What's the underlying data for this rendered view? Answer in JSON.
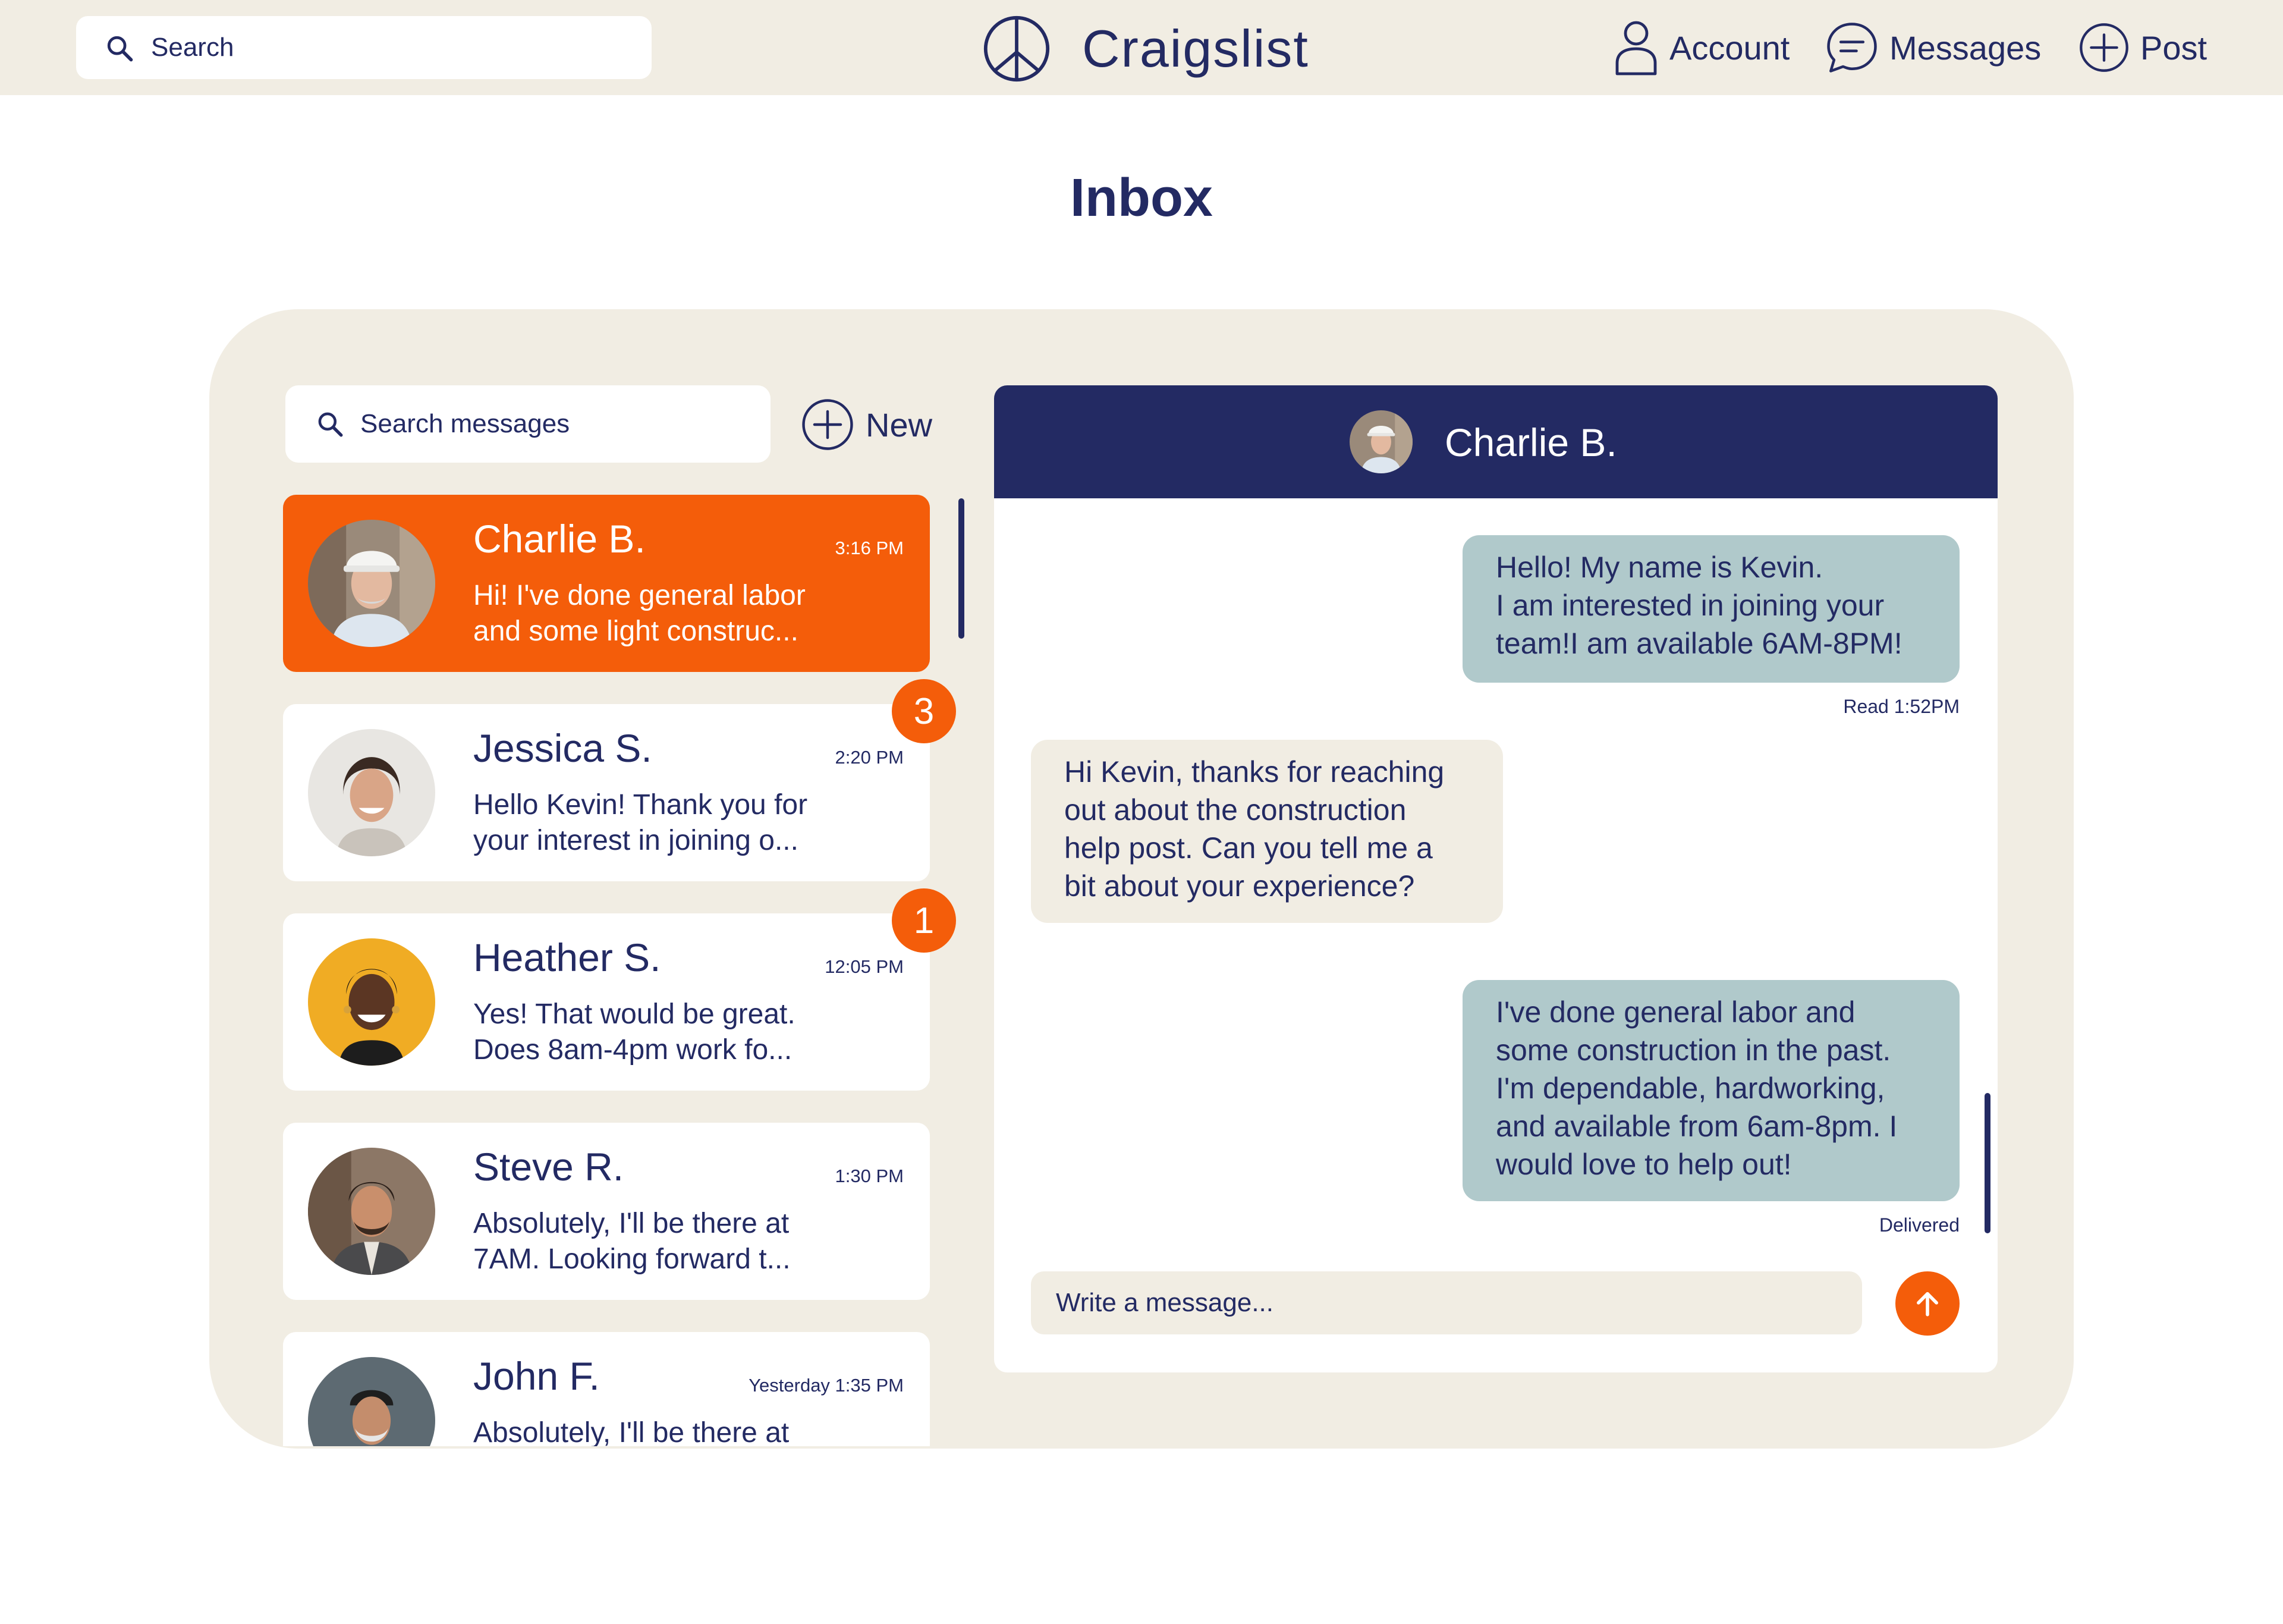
{
  "colors": {
    "navy": "#232a63",
    "beige": "#f1ede3",
    "orange": "#f45d0a",
    "outgoing_bubble": "#b0c9cb"
  },
  "header": {
    "search": {
      "placeholder": "Search",
      "icon": "search-icon"
    },
    "brand": {
      "name": "Craigslist",
      "icon": "peace-sign-icon"
    },
    "nav": [
      {
        "label": "Account",
        "icon": "user-icon"
      },
      {
        "label": "Messages",
        "icon": "chat-bubble-icon"
      },
      {
        "label": "Post",
        "icon": "plus-circle-icon"
      }
    ]
  },
  "page": {
    "title": "Inbox"
  },
  "inbox": {
    "search_placeholder": "Search messages",
    "new_label": "New",
    "conversations": [
      {
        "name": "Charlie B.",
        "time": "3:16 PM",
        "preview": "Hi! I've done general labor and some light construc...",
        "active": true
      },
      {
        "name": "Jessica S.",
        "time": "2:20 PM",
        "preview": "Hello Kevin! Thank you for your interest in joining o...",
        "unread": "3"
      },
      {
        "name": "Heather S.",
        "time": "12:05 PM",
        "preview": "Yes! That would be great. Does 8am-4pm work fo...",
        "unread": "1"
      },
      {
        "name": "Steve R.",
        "time": "1:30 PM",
        "preview": "Absolutely, I'll be there at 7AM. Looking forward t..."
      },
      {
        "name": "John F.",
        "time": "Yesterday 1:35 PM",
        "preview": "Absolutely, I'll be there at"
      }
    ]
  },
  "chat": {
    "contact_name": "Charlie B.",
    "messages": [
      {
        "direction": "outgoing",
        "lines": [
          "Hello! My name is Kevin.",
          "I am interested in joining your",
          "team!I am available 6AM-8PM!"
        ],
        "status": "Read 1:52PM"
      },
      {
        "direction": "incoming",
        "lines": [
          "Hi Kevin, thanks for reaching",
          "out about the construction",
          "help post. Can you tell me a",
          "bit about your experience?"
        ]
      },
      {
        "direction": "outgoing",
        "lines": [
          "I've done general labor and",
          "some construction in the past.",
          "I'm dependable, hardworking,",
          "and available from 6am-8pm. I",
          "would love to help out!"
        ],
        "status": "Delivered"
      }
    ],
    "compose_placeholder": "Write a message...",
    "send_icon": "arrow-up-icon"
  }
}
